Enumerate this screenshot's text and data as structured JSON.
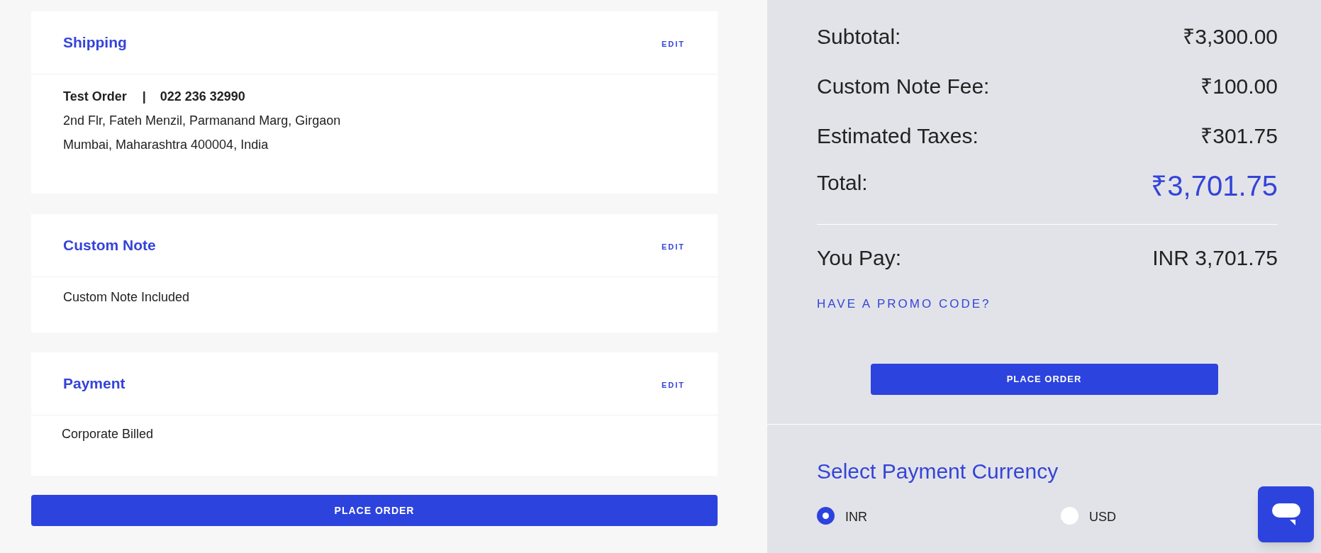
{
  "sections": [
    {
      "kind": "address",
      "title": "Shipping",
      "edit": "EDIT",
      "name": "Test Order",
      "separator": "|",
      "phone": "022 236 32990",
      "lines": [
        "2nd Flr, Fateh Menzil, Parmanand Marg, Girgaon",
        "Mumbai, Maharashtra 400004, India"
      ]
    },
    {
      "kind": "text",
      "title": "Custom Note",
      "edit": "EDIT",
      "text": "Custom Note Included"
    },
    {
      "kind": "text",
      "title": "Payment",
      "edit": "EDIT",
      "text": "Corporate Billed"
    }
  ],
  "place_order_button": "PLACE ORDER",
  "summary": {
    "rows": [
      {
        "label": "Subtotal:",
        "value": "₹3,300.00"
      },
      {
        "label": "Custom Note Fee:",
        "value": "₹100.00"
      },
      {
        "label": "Estimated Taxes:",
        "value": "₹301.75"
      }
    ],
    "total": {
      "label": "Total:",
      "value": "₹3,701.75"
    },
    "you_pay": {
      "label": "You Pay:",
      "value": "INR 3,701.75"
    },
    "promo_link": "HAVE A PROMO CODE?",
    "place_order_button": "PLACE ORDER"
  },
  "currency": {
    "title": "Select Payment Currency",
    "options": [
      {
        "label": "INR",
        "selected": true
      },
      {
        "label": "USD",
        "selected": false
      }
    ]
  }
}
